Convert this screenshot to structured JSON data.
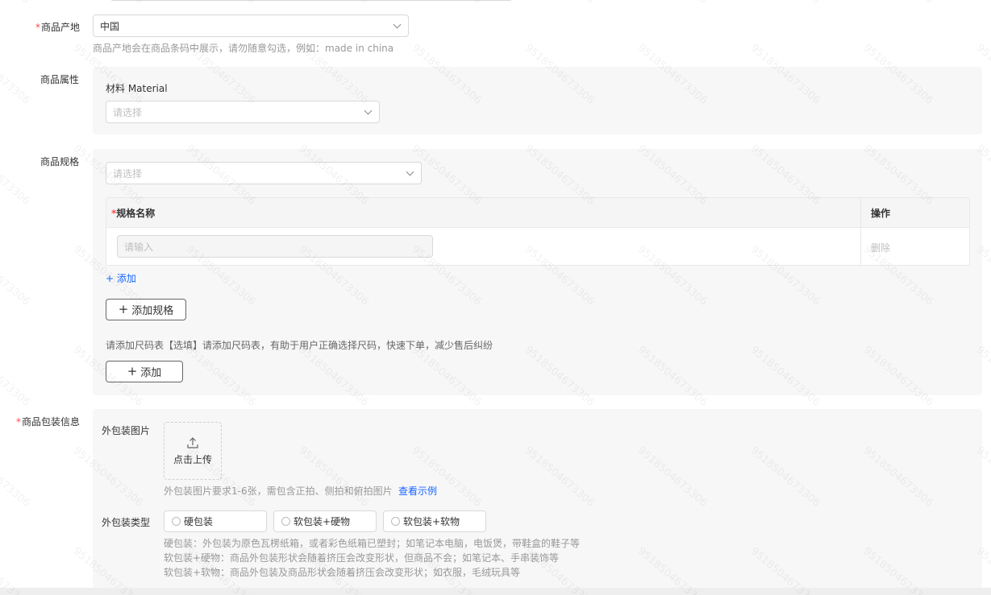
{
  "origin": {
    "label_required": "*",
    "label": "商品产地",
    "value": "中国",
    "hint": "商品产地会在商品条码中展示，请勿随意勾选，例如：made in china"
  },
  "attributes": {
    "label": "商品属性",
    "material_label": "材料 Material",
    "material_placeholder": "请选择"
  },
  "spec": {
    "label": "商品规格",
    "select_placeholder": "请选择",
    "table": {
      "header_required": "*",
      "header_name": "规格名称",
      "header_action": "操作",
      "row_placeholder": "请输入",
      "row_action": "删除"
    },
    "add_link": "+ 添加",
    "add_spec_button": "添加规格",
    "size_chart_hint": "请添加尺码表【选填】请添加尺码表，有助于用户正确选择尺码，快速下单，减少售后纠纷",
    "add_button": "添加"
  },
  "packaging": {
    "label_required": "*",
    "label": "商品包装信息",
    "image_label": "外包装图片",
    "upload_text": "点击上传",
    "image_hint": "外包装图片要求1-6张，需包含正拍、侧拍和俯拍图片",
    "example_link": "查看示例",
    "type_label": "外包装类型",
    "type_options": [
      "硬包装",
      "软包装+硬物",
      "软包装+软物"
    ],
    "type_desc": [
      "硬包装：外包装为原色瓦楞纸箱，或者彩色纸箱已塑封；如笔记本电脑，电饭煲，带鞋盒的鞋子等",
      "软包装+硬物：商品外包装形状会随着挤压会改变形状，但商品不会；如笔记本、手串装饰等",
      "软包装+软物：商品外包装及商品形状会随着挤压会改变形状；如衣服，毛绒玩具等"
    ]
  },
  "watermark_text": "9518504673306"
}
